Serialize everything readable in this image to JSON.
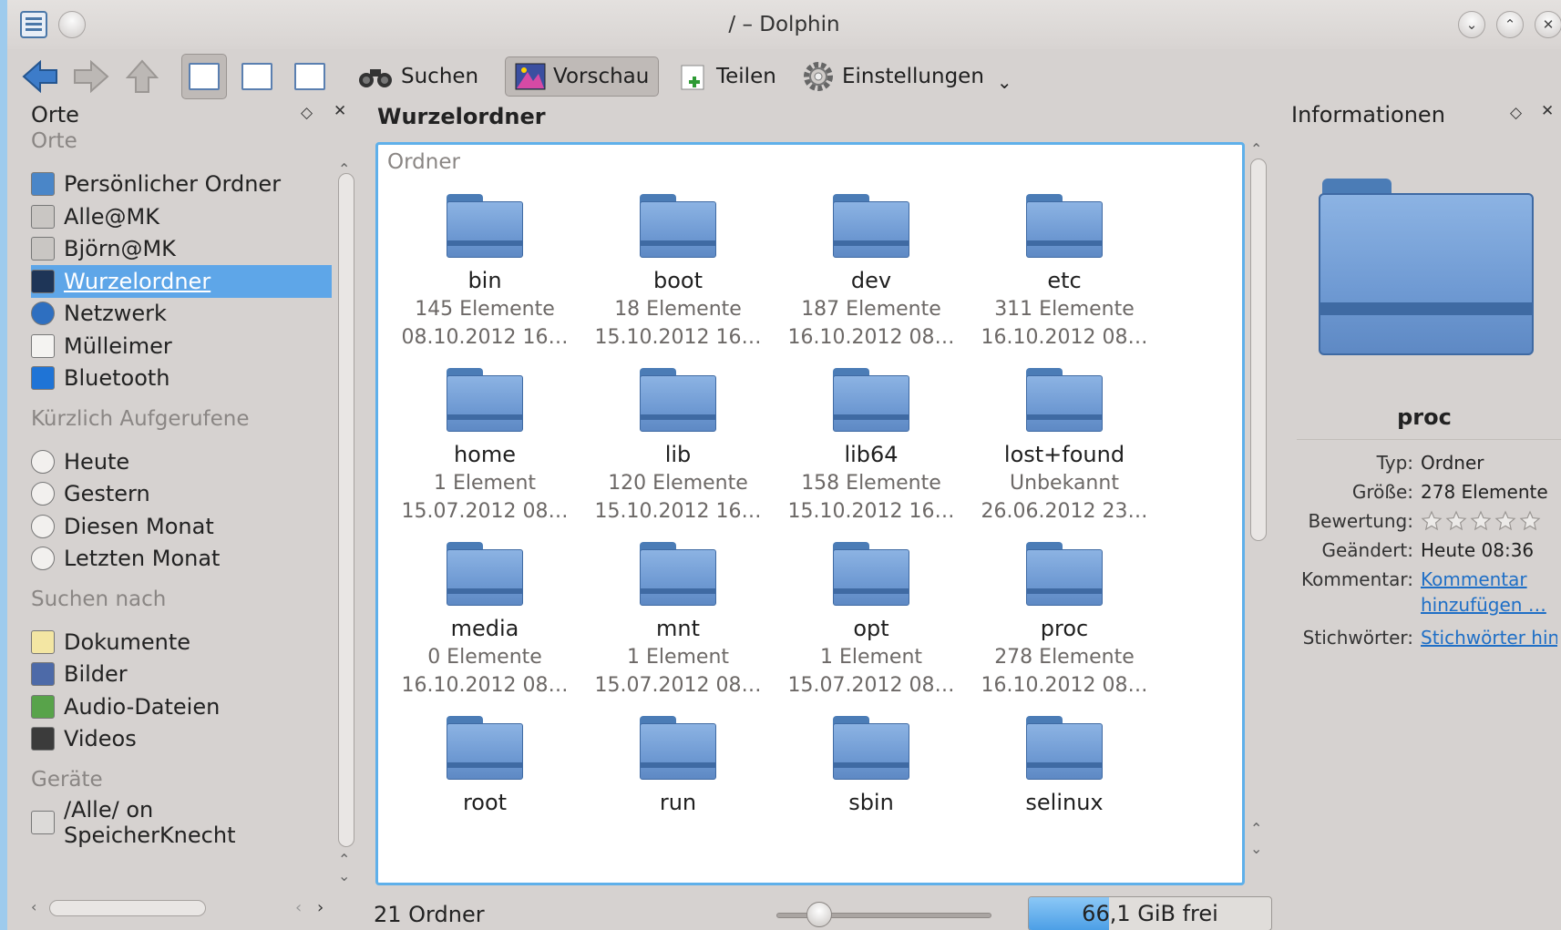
{
  "window": {
    "title": "/ – Dolphin"
  },
  "toolbar": {
    "search_label": "Suchen",
    "preview_label": "Vorschau",
    "share_label": "Teilen",
    "settings_label": "Einstellungen"
  },
  "places": {
    "panel_title": "Orte",
    "sections": [
      {
        "title": "Orte",
        "items": [
          {
            "label": "Persönlicher Ordner",
            "icon": "home-folder-icon"
          },
          {
            "label": "Alle@MK",
            "icon": "network-share-icon"
          },
          {
            "label": "Björn@MK",
            "icon": "network-share-icon"
          },
          {
            "label": "Wurzelordner",
            "icon": "root-folder-icon",
            "selected": true
          },
          {
            "label": "Netzwerk",
            "icon": "globe-icon"
          },
          {
            "label": "Mülleimer",
            "icon": "trash-icon"
          },
          {
            "label": "Bluetooth",
            "icon": "bluetooth-icon"
          }
        ]
      },
      {
        "title": "Kürzlich Aufgerufene",
        "items": [
          {
            "label": "Heute",
            "icon": "clock-icon"
          },
          {
            "label": "Gestern",
            "icon": "clock-icon"
          },
          {
            "label": "Diesen Monat",
            "icon": "clock-icon"
          },
          {
            "label": "Letzten Monat",
            "icon": "clock-icon"
          }
        ]
      },
      {
        "title": "Suchen nach",
        "items": [
          {
            "label": "Dokumente",
            "icon": "document-icon"
          },
          {
            "label": "Bilder",
            "icon": "image-icon"
          },
          {
            "label": "Audio-Dateien",
            "icon": "audio-icon"
          },
          {
            "label": "Videos",
            "icon": "video-icon"
          }
        ]
      },
      {
        "title": "Geräte",
        "items": [
          {
            "label": "/Alle/ on SpeicherKnecht",
            "icon": "drive-icon"
          }
        ]
      }
    ]
  },
  "main": {
    "breadcrumb": "Wurzelordner",
    "group_title": "Ordner",
    "items": [
      {
        "name": "bin",
        "count": "145 Elemente",
        "date": "08.10.2012 16…"
      },
      {
        "name": "boot",
        "count": "18 Elemente",
        "date": "15.10.2012 16…"
      },
      {
        "name": "dev",
        "count": "187 Elemente",
        "date": "16.10.2012 08…"
      },
      {
        "name": "etc",
        "count": "311 Elemente",
        "date": "16.10.2012 08…"
      },
      {
        "name": "home",
        "count": "1 Element",
        "date": "15.07.2012 08…"
      },
      {
        "name": "lib",
        "count": "120 Elemente",
        "date": "15.10.2012 16…"
      },
      {
        "name": "lib64",
        "count": "158 Elemente",
        "date": "15.10.2012 16…"
      },
      {
        "name": "lost+found",
        "count": "Unbekannt",
        "date": "26.06.2012 23…"
      },
      {
        "name": "media",
        "count": "0 Elemente",
        "date": "16.10.2012 08…"
      },
      {
        "name": "mnt",
        "count": "1 Element",
        "date": "15.07.2012 08…"
      },
      {
        "name": "opt",
        "count": "1 Element",
        "date": "15.07.2012 08…"
      },
      {
        "name": "proc",
        "count": "278 Elemente",
        "date": "16.10.2012 08…"
      },
      {
        "name": "root",
        "count": "",
        "date": ""
      },
      {
        "name": "run",
        "count": "",
        "date": ""
      },
      {
        "name": "sbin",
        "count": "",
        "date": ""
      },
      {
        "name": "selinux",
        "count": "",
        "date": ""
      }
    ]
  },
  "status": {
    "summary": "21 Ordner",
    "free_space": "66,1 GiB frei",
    "free_space_fill": 0.33,
    "zoom_level": 0.2
  },
  "info": {
    "panel_title": "Informationen",
    "name": "proc",
    "rows": [
      {
        "key": "Typ:",
        "value": "Ordner"
      },
      {
        "key": "Größe:",
        "value": "278 Elemente"
      },
      {
        "key": "Bewertung:",
        "value": ""
      },
      {
        "key": "Geändert:",
        "value": "Heute 08:36"
      },
      {
        "key": "Kommentar:",
        "value": "Kommentar hinzufügen …"
      },
      {
        "key": "Stichwörter:",
        "value": "Stichwörter hinzufügen"
      }
    ],
    "rating": 0
  },
  "colors": {
    "selection": "#5ea6e8",
    "accent_border": "#5fb0ea",
    "folder": "#6f9ad3",
    "link": "#1f6fc6"
  }
}
